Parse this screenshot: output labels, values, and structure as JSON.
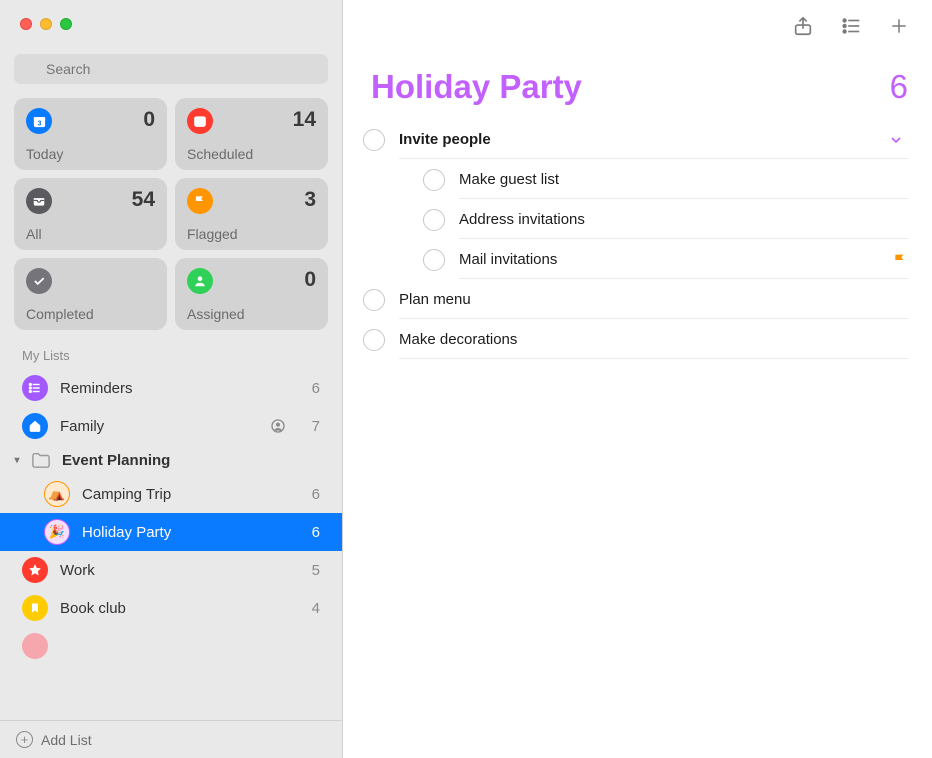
{
  "accent_color": "#c361ff",
  "sidebar": {
    "search_placeholder": "Search",
    "smart": [
      {
        "id": "today",
        "label": "Today",
        "count": 0
      },
      {
        "id": "scheduled",
        "label": "Scheduled",
        "count": 14
      },
      {
        "id": "all",
        "label": "All",
        "count": 54
      },
      {
        "id": "flagged",
        "label": "Flagged",
        "count": 3
      },
      {
        "id": "completed",
        "label": "Completed",
        "count": ""
      },
      {
        "id": "assigned",
        "label": "Assigned",
        "count": 0
      }
    ],
    "section_header": "My Lists",
    "lists": [
      {
        "name": "Reminders",
        "count": 6,
        "color": "#a259ff",
        "shared": false
      },
      {
        "name": "Family",
        "count": 7,
        "color": "#0a7aff",
        "shared": true
      }
    ],
    "group": {
      "name": "Event Planning",
      "expanded": true,
      "children": [
        {
          "name": "Camping Trip",
          "count": 6,
          "color": "#ff9500",
          "emoji": "⛺",
          "selected": false
        },
        {
          "name": "Holiday Party",
          "count": 6,
          "color": "#c361ff",
          "emoji": "🎉",
          "selected": true
        }
      ]
    },
    "lists_after_group": [
      {
        "name": "Work",
        "count": 5,
        "color": "#ff3b30",
        "glyph": "star"
      },
      {
        "name": "Book club",
        "count": 4,
        "color": "#ffcc00",
        "glyph": "bookmark"
      }
    ],
    "add_list_label": "Add List"
  },
  "main": {
    "title": "Holiday Party",
    "count": 6,
    "tasks": [
      {
        "text": "Invite people",
        "bold": true,
        "has_subtasks": true,
        "expanded": true,
        "flagged": false,
        "subtasks": [
          {
            "text": "Make guest list",
            "flagged": false
          },
          {
            "text": "Address invitations",
            "flagged": false
          },
          {
            "text": "Mail invitations",
            "flagged": true
          }
        ]
      },
      {
        "text": "Plan menu",
        "bold": false,
        "flagged": false
      },
      {
        "text": "Make decorations",
        "bold": false,
        "flagged": false
      }
    ]
  }
}
